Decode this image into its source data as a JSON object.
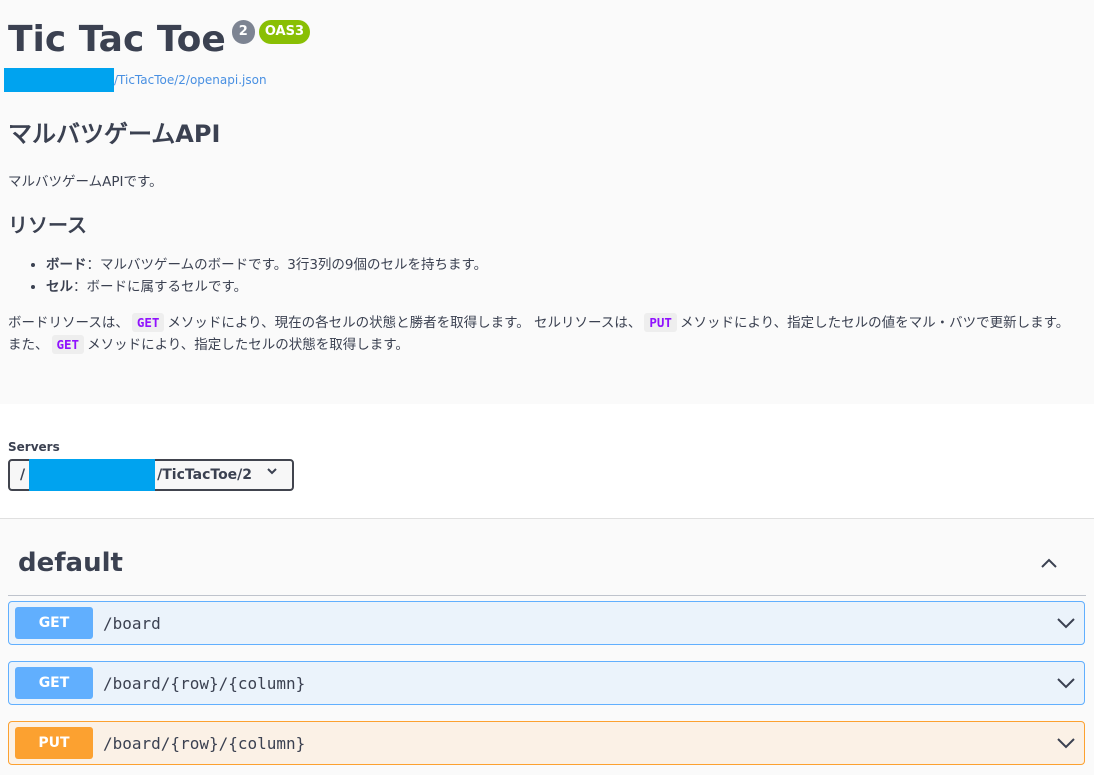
{
  "info": {
    "title": "Tic Tac Toe",
    "version": "2",
    "oas_badge": "OAS3",
    "spec_url_suffix": "/TicTacToe/2/openapi.json",
    "api_heading": "マルバツゲームAPI",
    "description": "マルバツゲームAPIです。",
    "resource_heading": "リソース",
    "resources": [
      {
        "name": "ボード",
        "text": "：マルバツゲームのボードです。3行3列の9個のセルを持ちます。"
      },
      {
        "name": "セル",
        "text": "：ボードに属するセルです。"
      }
    ],
    "para": {
      "p1": "ボードリソースは、",
      "code1": "GET",
      "p2": "メソッドにより、現在の各セルの状態と勝者を取得します。 セルリソースは、",
      "code2": "PUT",
      "p3": "メソッドにより、指定したセルの値をマル・バツで更新します。 また、",
      "code3": "GET",
      "p4": "メソッドにより、指定したセルの状態を取得します。"
    }
  },
  "servers": {
    "label": "Servers",
    "prefix": "/",
    "suffix": "/TicTacToe/2"
  },
  "section": {
    "title": "default"
  },
  "operations": [
    {
      "method": "GET",
      "path": "/board"
    },
    {
      "method": "GET",
      "path": "/board/{row}/{column}"
    },
    {
      "method": "PUT",
      "path": "/board/{row}/{column}"
    }
  ],
  "colors": {
    "get": "#61affe",
    "put": "#fca130",
    "oas": "#89bf04",
    "redaction": "#00a3ef"
  }
}
